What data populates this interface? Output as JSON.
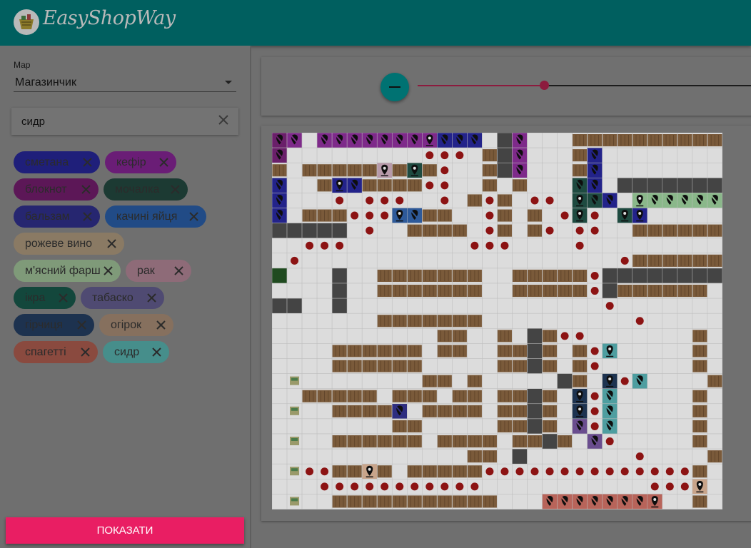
{
  "app": {
    "title": "EasyShopWay",
    "logo_icon": "shopping-basket-icon"
  },
  "sidebar": {
    "map_label": "Мар",
    "map_value": "Магазинчик",
    "search": {
      "value": "сидр",
      "placeholder": ""
    },
    "chips": [
      {
        "label": "сметана",
        "color": "#1f1f7a"
      },
      {
        "label": "кефір",
        "color": "#6a1d76"
      },
      {
        "label": "блокнот",
        "color": "#5c1757"
      },
      {
        "label": "мочалка",
        "color": "#1c3a33"
      },
      {
        "label": "бальзам",
        "color": "#262670"
      },
      {
        "label": "качині яйця",
        "color": "#214b86"
      },
      {
        "label": "рожеве вино",
        "color": "#8a7a64"
      },
      {
        "label": "м'ясний фарш",
        "color": "#7f9a79"
      },
      {
        "label": "рак",
        "color": "#8e6b78"
      },
      {
        "label": "ікра",
        "color": "#13473c"
      },
      {
        "label": "табаско",
        "color": "#4f4a72"
      },
      {
        "label": "гірчиця",
        "color": "#1d324f"
      },
      {
        "label": "огірок",
        "color": "#86705e"
      },
      {
        "label": "спагетті",
        "color": "#8a4a3f"
      },
      {
        "label": "сидр",
        "color": "#468e8b"
      }
    ],
    "show_button": "ПОКАЗАТИ"
  },
  "zoom": {
    "level": 0.3
  },
  "icons": {
    "search_clear": "close-icon",
    "zoom_out": "minus-icon",
    "chip_remove": "close-icon",
    "map_pin": "map-pin-icon",
    "map_pin_off": "map-pin-off-icon",
    "cash_register": "cash-register-icon"
  },
  "store_map": {
    "cols": 30,
    "rows": 25,
    "legend": {
      ".": "floor",
      "#": "shelf",
      "G": "wall",
      "K": "checkout",
      "D": "route-dot",
      "g": "green-tile",
      "a": "kefir-off",
      "A": "kefir-pin",
      "b": "smetana-off",
      "B": "smetana-pin",
      "c": "blaknot-off",
      "d": "balzam-off",
      "e": "rozheve-vyno-pin",
      "f": "mochalka-off",
      "F": "mochalka-pin",
      "h": "kachyni-yaitsia-off",
      "H": "kachyni-yaitsia-pin",
      "i": "ikra-pin",
      "j": "miasnyi-farsh-off",
      "J": "miasnyi-farsh-pin",
      "k": "syd r-off",
      "K2": "",
      "m": "hirchytsia-pin",
      "n": "tabasko-off",
      "N": "tabasko-pin",
      "p": "spaghetti-off",
      "P": "spaghetti-pin",
      "r": "rak-pin",
      "s": "syd r-pin",
      "t": "ohirok-pin"
    },
    "grid": [
      "ca.aaaaaaaAbbb.Ga...##########",
      "c.........DDD.#Ga...#b........",
      "#.#####e#F#D..#Ga...#b........",
      "b..#Bb####DD..#.#...fb.GGGGGGG",
      "b...D.DDD..D.#D#.DD.Ffb.JjjjjjjJ",
      "b.###DDDHh##..D#.#.DFD.FB.......",
      "GGGGG.D..####.D#.#D.DD..######",
      "..DDD........DDD....D.........",
      ".D.....................D######",
      "g...G..#######..#####DGGGGGGGG",
      "....G..#######..#####DG######.#",
      "GG..G.................D.......#",
      ".......#######..........D.....#",
      "...........##..#.G#DD.......#",
      "....######.##..##G#.#Ds.....#",
      "....######.....##G#.#D......#",
      ".K........##.#.....G#.mDn....#",
      "..#####.###.##.##G#.mDn.....#",
      ".K..####d.####.##G#.mDn.....#",
      "........##.....##G#.NDn.....#",
      ".K..######.####.##G#.ND.....#",
      ".............##.G.......D....#",
      ".KDD##t#.#####DDDDDDDDDDDDDD#",
      "...DDDDDDDDDDD...........DDDt",
      ".K..###########...pppppppP..#"
    ]
  }
}
